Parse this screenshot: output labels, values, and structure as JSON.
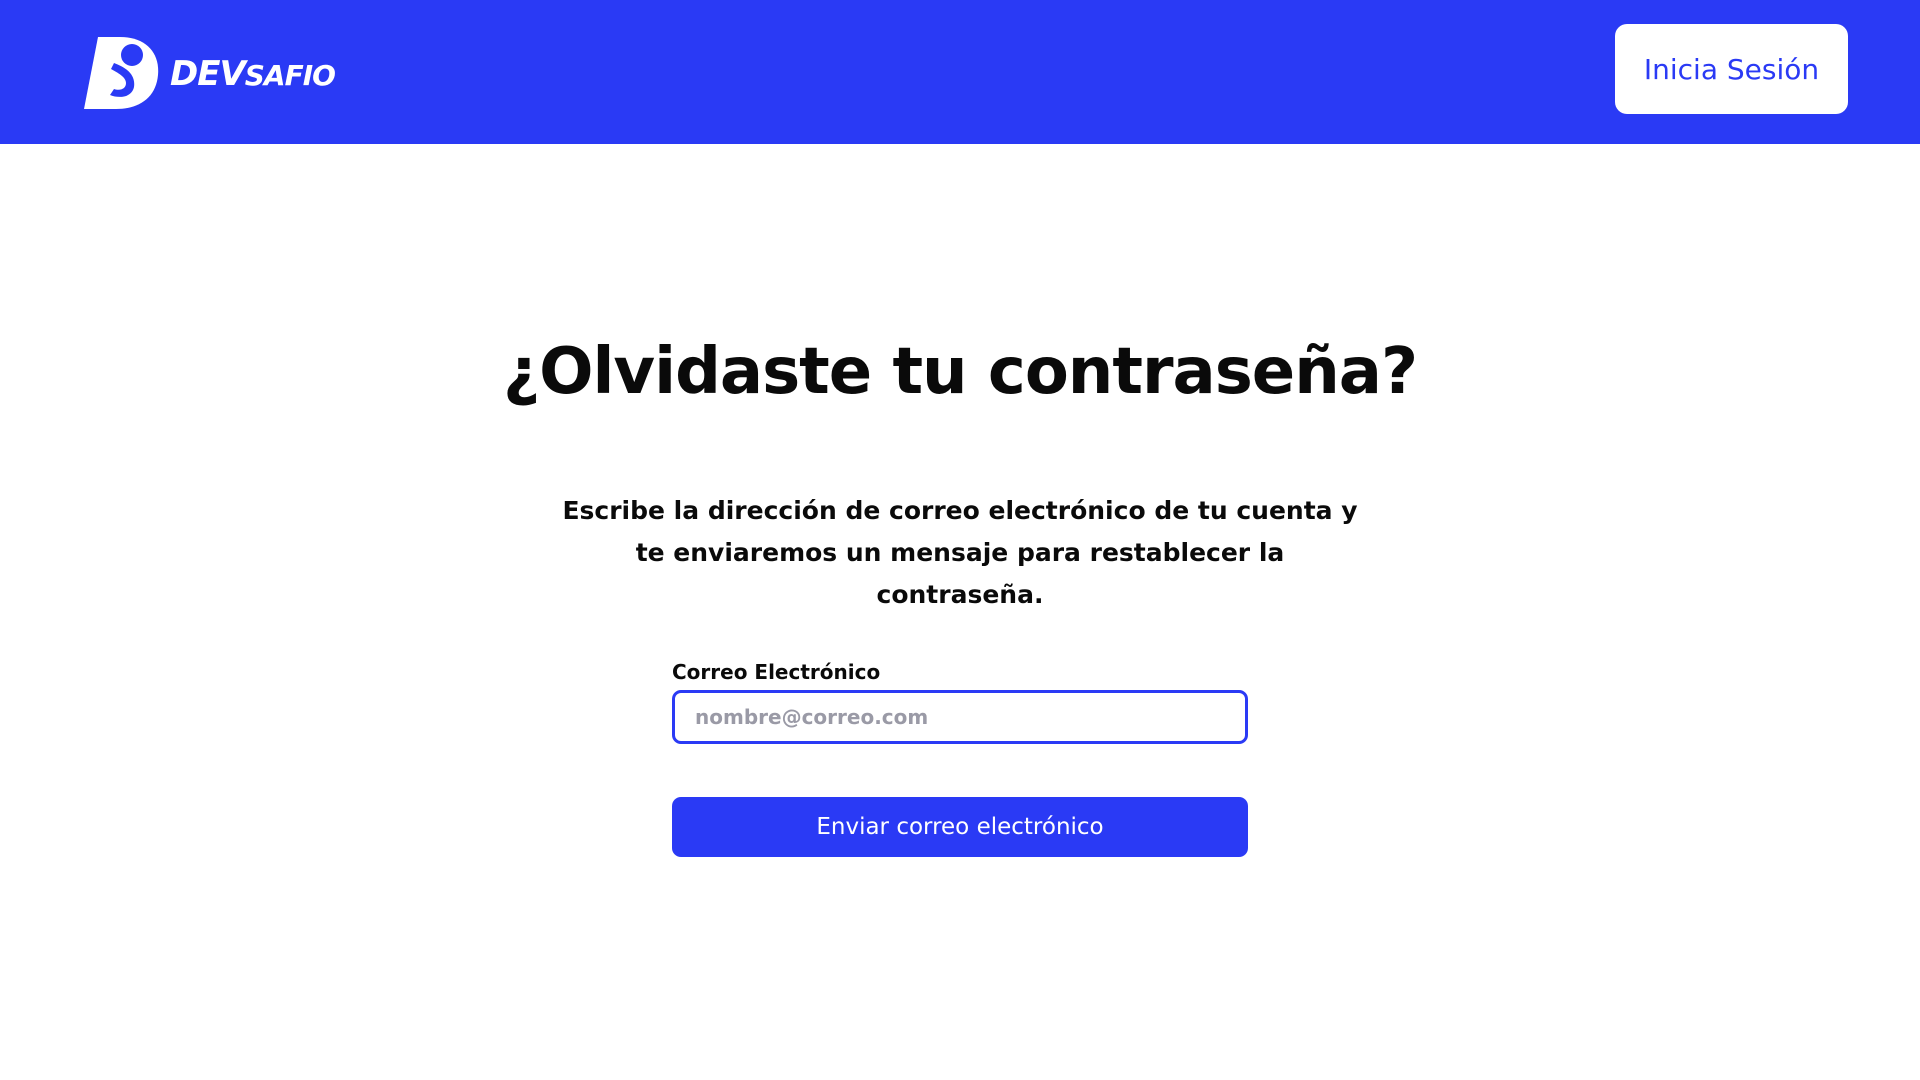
{
  "header": {
    "logo": {
      "icon": "devsafio-logo-icon",
      "text_dev": "DEV",
      "text_safio": "SAFIO"
    },
    "login_label": "Inicia Sesión"
  },
  "main": {
    "title": "¿Olvidaste tu contraseña?",
    "description_lines": [
      "Escribe la dirección de correo electrónico de tu cuenta y",
      "te enviaremos un mensaje para restablecer la",
      "contraseña."
    ],
    "email_label": "Correo Electrónico",
    "email_value": "",
    "email_placeholder": "nombre@correo.com",
    "submit_label": "Enviar correo electrónico"
  },
  "colors": {
    "brand": "#2a3af5",
    "text": "#0a0a0a",
    "background": "#ffffff",
    "placeholder": "#9a9aa6"
  }
}
